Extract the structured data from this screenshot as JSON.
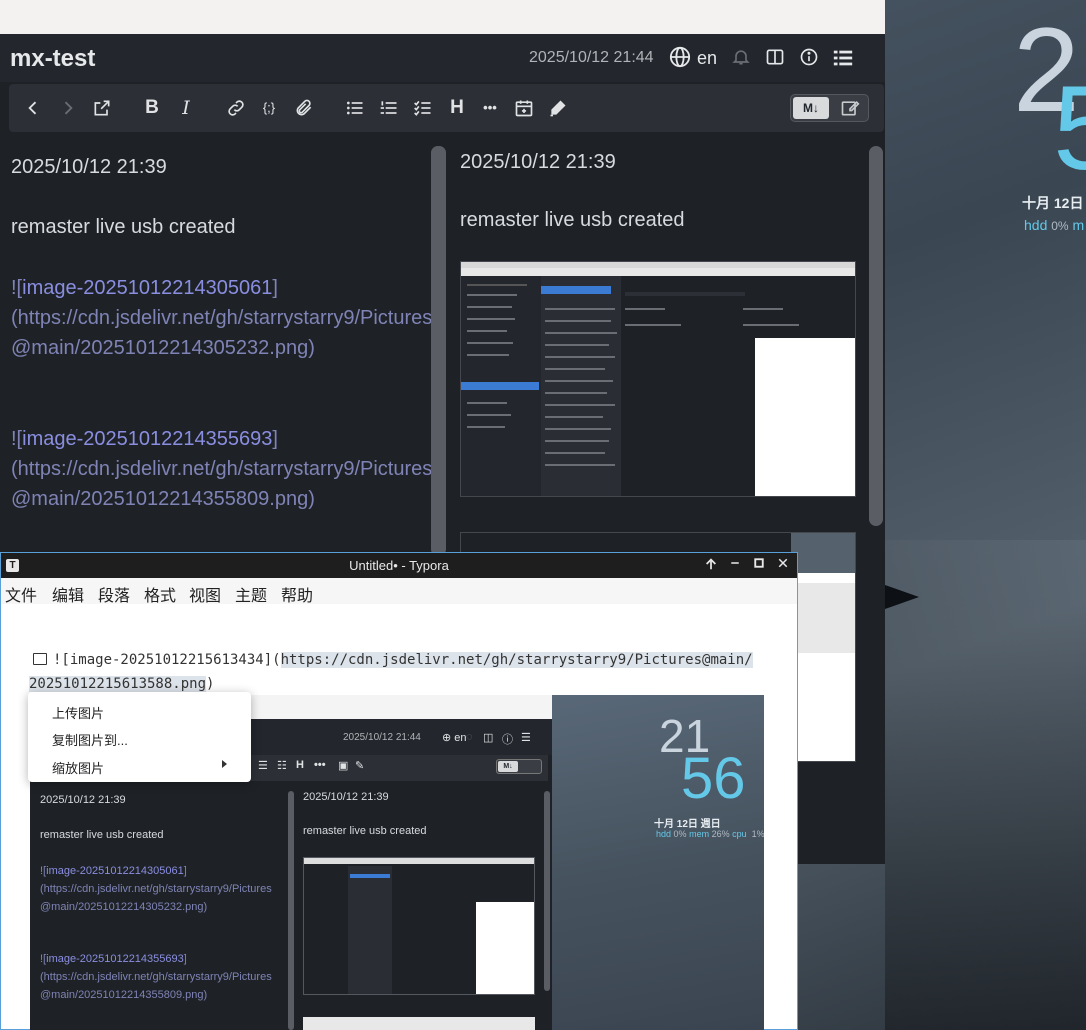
{
  "desktop": {
    "clock_hour": "2",
    "clock_minute": "5",
    "date": "十月 12日 週",
    "sys": {
      "hdd_label": "hdd",
      "hdd_pct": "0%",
      "mem_label": "m"
    }
  },
  "app": {
    "title": "mx-test",
    "datetime": "2025/10/12 21:44",
    "language": "en",
    "icons": [
      "globe-icon",
      "bell-icon",
      "columns-icon",
      "info-icon",
      "menu-list-icon"
    ],
    "toolbar": {
      "icons": [
        "back-icon",
        "forward-icon",
        "external-link-icon",
        "bold-icon",
        "italic-icon",
        "link-icon",
        "code-icon",
        "attachment-icon",
        "bullet-list-icon",
        "numbered-list-icon",
        "checklist-icon",
        "heading-icon",
        "more-icon",
        "calendar-icon",
        "pen-icon"
      ],
      "bold": "B",
      "italic": "I",
      "heading": "H",
      "more": "•••",
      "code": "{;}",
      "markdown_toggle": "M↓"
    },
    "editor": {
      "date": "2025/10/12 21:39",
      "line1": "remaster live usb created",
      "img1_prefix": "![",
      "img1_name": "image-20251012214305061",
      "img1_suffix": "]",
      "img1_url_a": "(https://cdn.jsdelivr.net/gh/starrystarry9/Pictures",
      "img1_url_b": "@main/20251012214305232.png)",
      "img2_prefix": "![",
      "img2_name": "image-20251012214355693",
      "img2_suffix": "]",
      "img2_url_a": "(https://cdn.jsdelivr.net/gh/starrystarry9/Pictures",
      "img2_url_b": "@main/20251012214355809.png)"
    },
    "preview": {
      "date": "2025/10/12 21:39",
      "line1": "remaster live usb created"
    }
  },
  "typora": {
    "title": "Untitled• - Typora",
    "menu": [
      "文件",
      "编辑",
      "段落",
      "格式",
      "视图",
      "主题",
      "帮助"
    ],
    "code_prefix": "![image-20251012215613434](",
    "code_url_a": "https://cdn.jsdelivr.net/gh/starrystarry9/Pictures@main/",
    "code_url_b": "20251012215613588.png",
    "code_suffix": ")",
    "context_menu": [
      "上传图片",
      "复制图片到...",
      "缩放图片"
    ]
  },
  "nested": {
    "datetime": "2025/10/12 21:44",
    "language": "en",
    "editor": {
      "date": "2025/10/12 21:39",
      "line1": "remaster live usb created",
      "img1_name": "image-20251012214305061",
      "img1_url_a": "(https://cdn.jsdelivr.net/gh/starrystarry9/Pictures",
      "img1_url_b": "@main/20251012214305232.png)",
      "img2_name": "image-20251012214355693",
      "img2_url_a": "(https://cdn.jsdelivr.net/gh/starrystarry9/Pictures",
      "img2_url_b": "@main/20251012214355809.png)"
    },
    "preview": {
      "date": "2025/10/12 21:39",
      "line1": "remaster live usb created"
    },
    "desk": {
      "hour": "21",
      "minute": "56",
      "date": "十月 12日 週日",
      "hdd_label": "hdd",
      "hdd_pct": "0%",
      "mem_label": "mem",
      "mem_pct": "26%",
      "cpu_label": "cpu",
      "cpu_pct": "1%"
    }
  },
  "colors": {
    "app_bg": "#1e2227",
    "link": "#8a8ee0",
    "accent_cyan": "#64c8e8",
    "selection": "#3b7bd4"
  }
}
